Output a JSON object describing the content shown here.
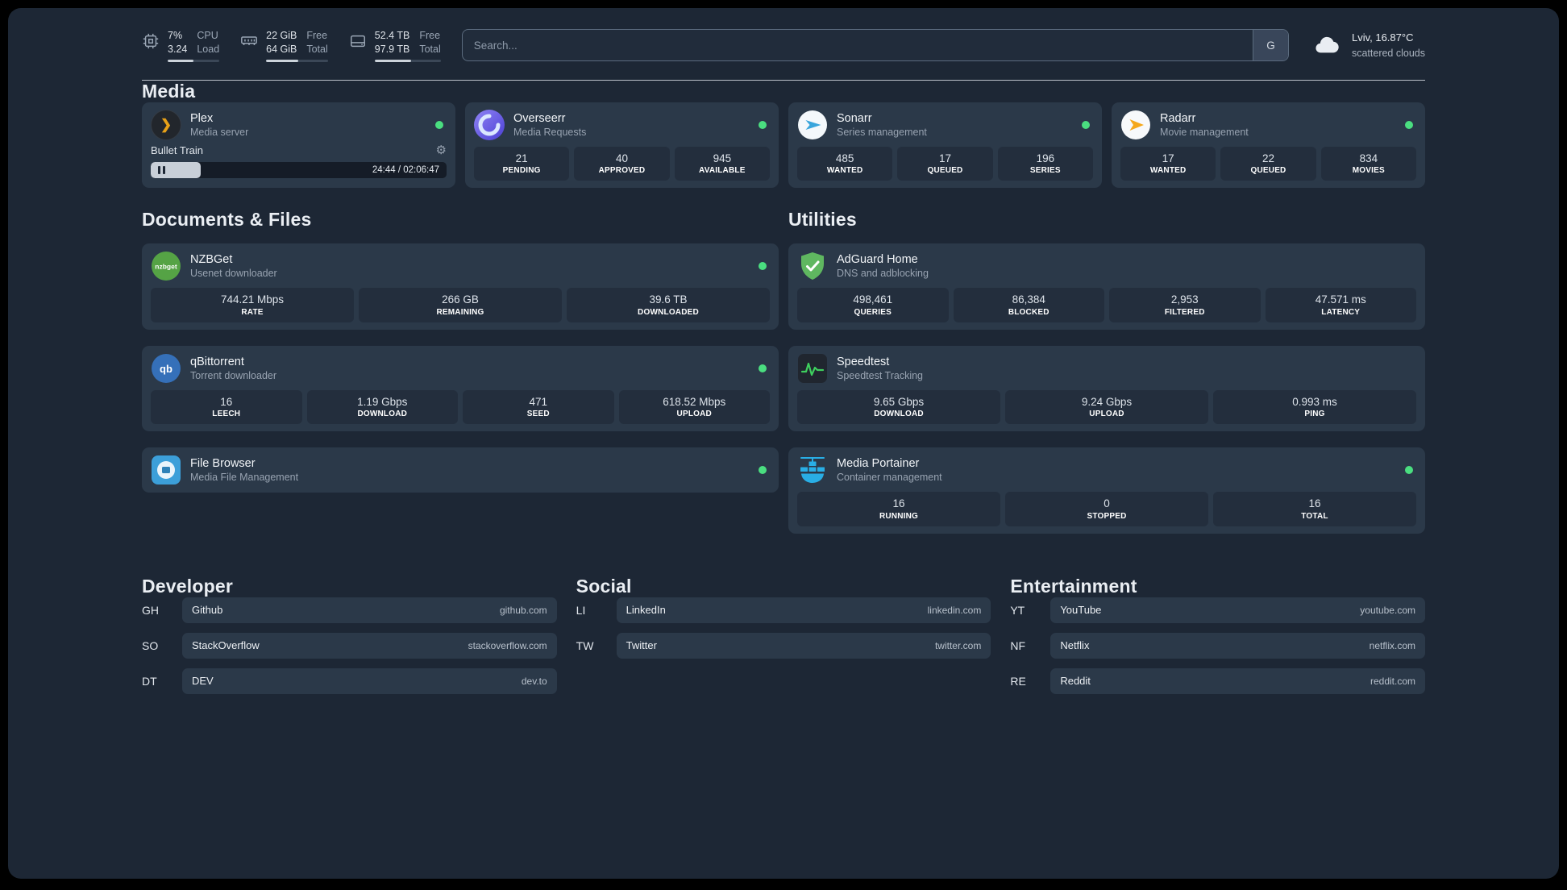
{
  "colors": {
    "page_bg": "#1d2735",
    "card_bg": "#2b3949",
    "tile_bg": "#232e3d",
    "status_online": "#4ade80",
    "plex_accent": "#e8a118"
  },
  "header": {
    "resources": {
      "cpu": {
        "value_top": "7%",
        "value_bottom": "3.24",
        "label_top": "CPU",
        "label_bottom": "Load"
      },
      "memory": {
        "value_top": "22 GiB",
        "value_bottom": "64 GiB",
        "label_top": "Free",
        "label_bottom": "Total"
      },
      "disk": {
        "value_top": "52.4 TB",
        "value_bottom": "97.9 TB",
        "label_top": "Free",
        "label_bottom": "Total"
      }
    },
    "search": {
      "placeholder": "Search...",
      "provider_button": "G"
    },
    "weather": {
      "location": "Lviv, 16.87°C",
      "condition": "scattered clouds"
    }
  },
  "sections": {
    "media": "Media",
    "documents": "Documents & Files",
    "utilities": "Utilities"
  },
  "services": {
    "plex": {
      "name": "Plex",
      "desc": "Media server",
      "now_playing": "Bullet Train",
      "time": "24:44 / 02:06:47",
      "progress_percent": 17
    },
    "overseerr": {
      "name": "Overseerr",
      "desc": "Media Requests",
      "stats": [
        {
          "value": "21",
          "label": "PENDING"
        },
        {
          "value": "40",
          "label": "APPROVED"
        },
        {
          "value": "945",
          "label": "AVAILABLE"
        }
      ]
    },
    "sonarr": {
      "name": "Sonarr",
      "desc": "Series management",
      "stats": [
        {
          "value": "485",
          "label": "WANTED"
        },
        {
          "value": "17",
          "label": "QUEUED"
        },
        {
          "value": "196",
          "label": "SERIES"
        }
      ]
    },
    "radarr": {
      "name": "Radarr",
      "desc": "Movie management",
      "stats": [
        {
          "value": "17",
          "label": "WANTED"
        },
        {
          "value": "22",
          "label": "QUEUED"
        },
        {
          "value": "834",
          "label": "MOVIES"
        }
      ]
    },
    "nzbget": {
      "name": "NZBGet",
      "desc": "Usenet downloader",
      "stats": [
        {
          "value": "744.21 Mbps",
          "label": "RATE"
        },
        {
          "value": "266 GB",
          "label": "REMAINING"
        },
        {
          "value": "39.6 TB",
          "label": "DOWNLOADED"
        }
      ]
    },
    "qbittorrent": {
      "name": "qBittorrent",
      "desc": "Torrent downloader",
      "stats": [
        {
          "value": "16",
          "label": "LEECH"
        },
        {
          "value": "1.19 Gbps",
          "label": "DOWNLOAD"
        },
        {
          "value": "471",
          "label": "SEED"
        },
        {
          "value": "618.52 Mbps",
          "label": "UPLOAD"
        }
      ]
    },
    "filebrowser": {
      "name": "File Browser",
      "desc": "Media File Management"
    },
    "adguard": {
      "name": "AdGuard Home",
      "desc": "DNS and adblocking",
      "stats": [
        {
          "value": "498,461",
          "label": "QUERIES"
        },
        {
          "value": "86,384",
          "label": "BLOCKED"
        },
        {
          "value": "2,953",
          "label": "FILTERED"
        },
        {
          "value": "47.571 ms",
          "label": "LATENCY"
        }
      ]
    },
    "speedtest": {
      "name": "Speedtest",
      "desc": "Speedtest Tracking",
      "stats": [
        {
          "value": "9.65 Gbps",
          "label": "DOWNLOAD"
        },
        {
          "value": "9.24 Gbps",
          "label": "UPLOAD"
        },
        {
          "value": "0.993 ms",
          "label": "PING"
        }
      ]
    },
    "portainer": {
      "name": "Media Portainer",
      "desc": "Container management",
      "stats": [
        {
          "value": "16",
          "label": "RUNNING"
        },
        {
          "value": "0",
          "label": "STOPPED"
        },
        {
          "value": "16",
          "label": "TOTAL"
        }
      ]
    }
  },
  "bookmarks": {
    "developer": {
      "title": "Developer",
      "items": [
        {
          "abbr": "GH",
          "name": "Github",
          "href": "github.com"
        },
        {
          "abbr": "SO",
          "name": "StackOverflow",
          "href": "stackoverflow.com"
        },
        {
          "abbr": "DT",
          "name": "DEV",
          "href": "dev.to"
        }
      ]
    },
    "social": {
      "title": "Social",
      "items": [
        {
          "abbr": "LI",
          "name": "LinkedIn",
          "href": "linkedin.com"
        },
        {
          "abbr": "TW",
          "name": "Twitter",
          "href": "twitter.com"
        }
      ]
    },
    "entertainment": {
      "title": "Entertainment",
      "items": [
        {
          "abbr": "YT",
          "name": "YouTube",
          "href": "youtube.com"
        },
        {
          "abbr": "NF",
          "name": "Netflix",
          "href": "netflix.com"
        },
        {
          "abbr": "RE",
          "name": "Reddit",
          "href": "reddit.com"
        }
      ]
    }
  }
}
